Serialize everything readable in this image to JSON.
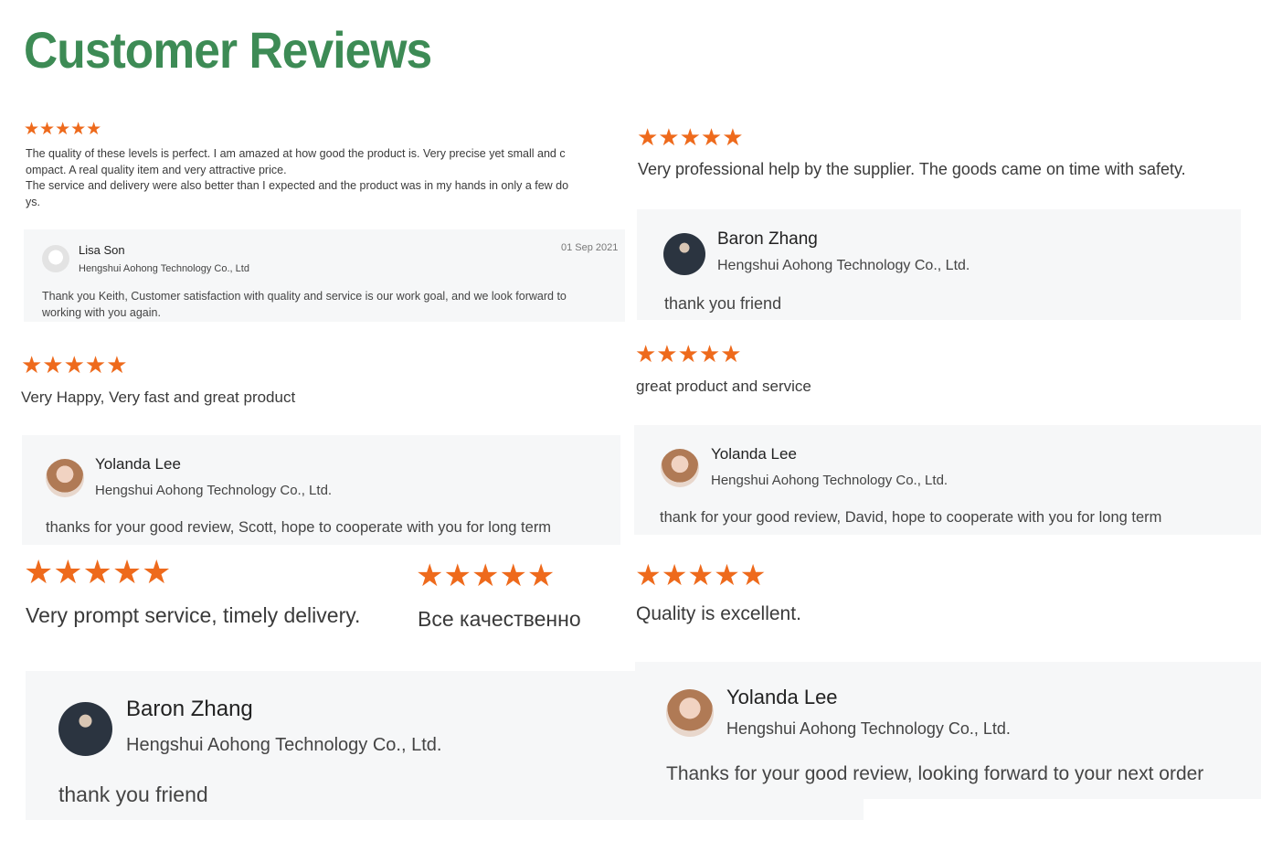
{
  "page": {
    "title": "Customer Reviews"
  },
  "rating_stars": "★★★★★",
  "colors": {
    "title": "#3d8b55",
    "star": "#ee6a1c",
    "reply_bg": "#f6f7f8"
  },
  "reviews": [
    {
      "text_lines": [
        "The quality of these levels is perfect. I am amazed at how good the product is. Very precise yet small and c",
        "ompact. A real quality item and very attractive price.",
        "The service and delivery were also better than I expected and the product was in  my hands in only a few do",
        "ys."
      ],
      "reply": {
        "name": "Lisa Son",
        "company": "Hengshui Aohong Technology Co., Ltd",
        "date": "01 Sep 2021",
        "text_lines": [
          "Thank you Keith,  Customer satisfaction with quality and service is our work goal, and we look forward to",
          "working with you again."
        ],
        "avatar": "logo-avatar"
      }
    },
    {
      "text": "Very professional help by the supplier. The goods came on time with safety.",
      "reply": {
        "name": "Baron Zhang",
        "company": "Hengshui Aohong Technology Co., Ltd.",
        "text": "thank you friend",
        "avatar": "man-avatar"
      }
    },
    {
      "text": "Very Happy, Very fast and great product",
      "reply": {
        "name": "Yolanda Lee",
        "company": "Hengshui Aohong Technology Co., Ltd.",
        "text": "thanks for your good review, Scott, hope to cooperate with you for long term",
        "avatar": "woman-avatar"
      }
    },
    {
      "text": "great product and service",
      "reply": {
        "name": "Yolanda Lee",
        "company": "Hengshui Aohong Technology Co., Ltd.",
        "text": "thank for your good review, David, hope to cooperate with you for long term",
        "avatar": "woman-avatar"
      }
    },
    {
      "text": "Very prompt service, timely delivery."
    },
    {
      "text": "Все качественно"
    },
    {
      "text": "Quality is excellent."
    },
    {
      "reply": {
        "name": "Baron Zhang",
        "company": "Hengshui Aohong Technology Co., Ltd.",
        "text": "thank you friend",
        "avatar": "man-avatar"
      }
    },
    {
      "reply": {
        "name": "Yolanda Lee",
        "company": "Hengshui Aohong Technology Co., Ltd.",
        "text": "Thanks for your good review, looking forward to your next order",
        "avatar": "woman-avatar"
      }
    }
  ]
}
